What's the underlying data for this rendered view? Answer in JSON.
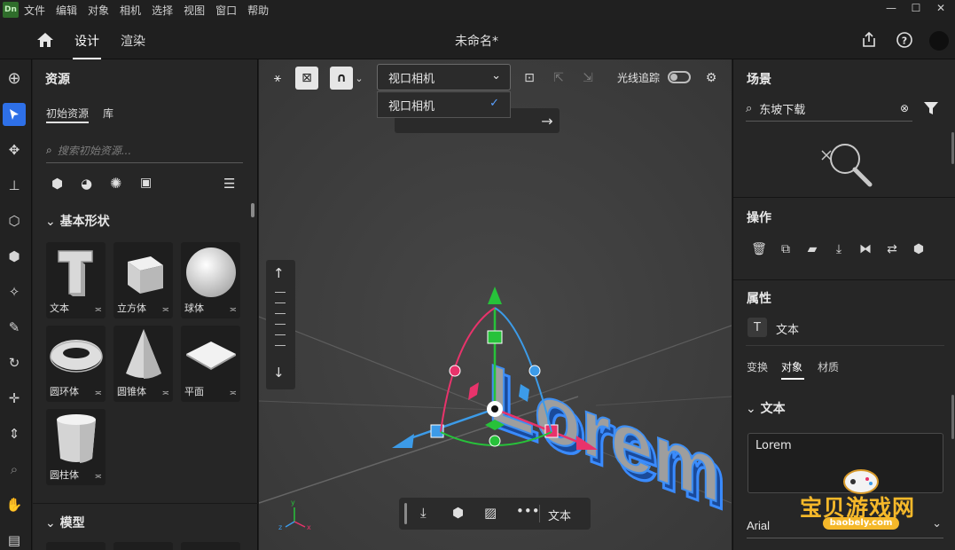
{
  "menubar": {
    "logo": "Dn",
    "items": [
      "文件",
      "编辑",
      "对象",
      "相机",
      "选择",
      "视图",
      "窗口",
      "帮助"
    ],
    "minimize": "—",
    "maximize": "☐",
    "close": "✕"
  },
  "header": {
    "tabs": [
      {
        "label": "设计"
      },
      {
        "label": "渲染"
      }
    ],
    "title": "未命名*"
  },
  "assets": {
    "title": "资源",
    "subtabs": [
      "初始资源",
      "库"
    ],
    "search_placeholder": "搜索初始资源...",
    "section_basic": "基本形状",
    "section_models": "模型",
    "shapes": [
      {
        "label": "文本"
      },
      {
        "label": "立方体"
      },
      {
        "label": "球体"
      },
      {
        "label": "圆环体"
      },
      {
        "label": "圆锥体"
      },
      {
        "label": "平面"
      },
      {
        "label": "圆柱体"
      }
    ]
  },
  "viewport": {
    "camera_selected": "视口相机",
    "camera_option": "视口相机",
    "raytrace_label": "光线追踪",
    "raytrace_on": false,
    "scene_text": "Lorem",
    "bottom_label": "文本",
    "axis_x": "x",
    "axis_y": "y",
    "axis_z": "z"
  },
  "right": {
    "scene_title": "场景",
    "scene_search": "东坡下载",
    "ops_title": "操作",
    "props_title": "属性",
    "selected_object": "文本",
    "prop_tabs": [
      "变换",
      "对象",
      "材质"
    ],
    "text_section": "文本",
    "text_value": "Lorem",
    "font": "Arial"
  },
  "watermark": {
    "text": "宝贝游戏网",
    "url": "baobely.com"
  },
  "colors": {
    "accent": "#2e70e8",
    "gizmo_green": "#27c23a",
    "gizmo_red": "#e8336b",
    "gizmo_blue": "#3c9be8"
  }
}
